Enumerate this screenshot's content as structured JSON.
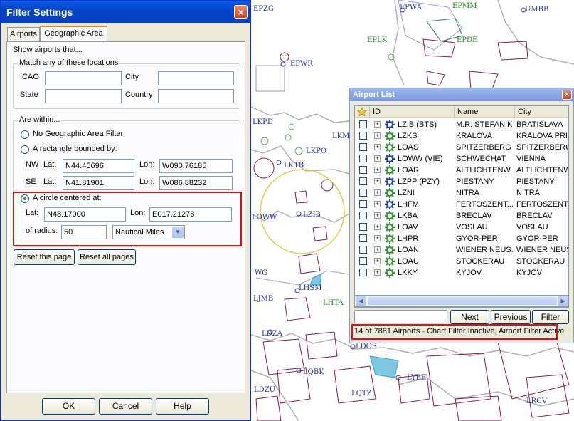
{
  "map": {
    "labels": [
      {
        "text": "EPZG",
        "color": "#2233aa"
      },
      {
        "text": "EPWA",
        "color": "#2233aa"
      },
      {
        "text": "EPMM",
        "color": "#228822"
      },
      {
        "text": "UMBB",
        "color": "#2233aa"
      },
      {
        "text": "EPLK",
        "color": "#228822"
      },
      {
        "text": "EPDE",
        "color": "#228822"
      },
      {
        "text": "EPWR",
        "color": "#2233aa"
      },
      {
        "text": "LKPD",
        "color": "#2233aa"
      },
      {
        "text": "LKM",
        "color": "#2233aa"
      },
      {
        "text": "LKPO",
        "color": "#2233aa"
      },
      {
        "text": "LKTB",
        "color": "#2233aa"
      },
      {
        "text": "LOWW",
        "color": "#2233aa"
      },
      {
        "text": "LZIB",
        "color": "#2233aa"
      },
      {
        "text": "WG",
        "color": "#2233aa"
      },
      {
        "text": "LHSM",
        "color": "#2233aa"
      },
      {
        "text": "LJMB",
        "color": "#2233aa"
      },
      {
        "text": "LHTA",
        "color": "#228822"
      },
      {
        "text": "LDZA",
        "color": "#2233aa"
      },
      {
        "text": "LDOS",
        "color": "#2233aa"
      },
      {
        "text": "LQBK",
        "color": "#2233aa"
      },
      {
        "text": "LYBE",
        "color": "#2233aa"
      },
      {
        "text": "LDZU",
        "color": "#2233aa"
      },
      {
        "text": "LQTZ",
        "color": "#2233aa"
      },
      {
        "text": "LRCV",
        "color": "#2233aa"
      }
    ]
  },
  "filter_window": {
    "title": "Filter Settings",
    "close_label": "×",
    "tabs": [
      {
        "label": "Airports"
      },
      {
        "label": "Geographic Area"
      }
    ],
    "intro": "Show airports that...",
    "match_group": {
      "title": "Match any of these locations",
      "icao_label": "ICAO",
      "icao_value": "",
      "city_label": "City",
      "city_value": "",
      "state_label": "State",
      "state_value": "",
      "country_label": "Country",
      "country_value": ""
    },
    "within_group": {
      "title": "Are within...",
      "opt_none": "No Geographic Area Filter",
      "opt_rect": "A rectangle bounded by:",
      "nw_label": "NW",
      "se_label": "SE",
      "lat_label": "Lat:",
      "lon_label": "Lon:",
      "nw_lat": "N44.45696",
      "nw_lon": "W090.76185",
      "se_lat": "N41.81901",
      "se_lon": "W086.88232",
      "opt_circle": "A circle centered at:",
      "circle_lat": "N48.17000",
      "circle_lon": "E017.21278",
      "radius_label": "of radius:",
      "radius_value": "50",
      "unit_value": "Nautical Miles"
    },
    "reset_page": "Reset this page",
    "reset_all": "Reset all pages",
    "ok": "OK",
    "cancel": "Cancel",
    "help": "Help"
  },
  "airport_list": {
    "title": "Airport List",
    "close_label": "×",
    "columns": {
      "id": "ID",
      "name": "Name",
      "city": "City"
    },
    "rows": [
      {
        "id": "LZIB (BTS)",
        "name": "M.R. STEFANIK",
        "city": "BRATISLAVA",
        "icon_color": "#1a3fb0"
      },
      {
        "id": "LZKS",
        "name": "KRALOVA",
        "city": "KRALOVA PRI S",
        "icon_color": "#2a9a2a"
      },
      {
        "id": "LOAS",
        "name": "SPITZERBERG",
        "city": "SPITZERBERG",
        "icon_color": "#2a9a2a"
      },
      {
        "id": "LOWW (VIE)",
        "name": "SCHWECHAT",
        "city": "VIENNA",
        "icon_color": "#1a3fb0"
      },
      {
        "id": "LOAR",
        "name": "ALTLICHTENW...",
        "city": "ALTLICHTENWA",
        "icon_color": "#2a9a2a"
      },
      {
        "id": "LZPP (PZY)",
        "name": "PIESTANY",
        "city": "PIESTANY",
        "icon_color": "#1a3fb0"
      },
      {
        "id": "LZNI",
        "name": "NITRA",
        "city": "NITRA",
        "icon_color": "#2a9a2a"
      },
      {
        "id": "LHFM",
        "name": "FERTOSZENT...",
        "city": "FERTOSZENTMI",
        "icon_color": "#1a3fb0"
      },
      {
        "id": "LKBA",
        "name": "BRECLAV",
        "city": "BRECLAV",
        "icon_color": "#2a9a2a"
      },
      {
        "id": "LOAV",
        "name": "VOSLAU",
        "city": "VOSLAU",
        "icon_color": "#2a9a2a"
      },
      {
        "id": "LHPR",
        "name": "GYOR-PER",
        "city": "GYOR-PER",
        "icon_color": "#2a9a2a"
      },
      {
        "id": "LOAN",
        "name": "WIENER NEUS...",
        "city": "WIENER NEUST",
        "icon_color": "#2a9a2a"
      },
      {
        "id": "LOAU",
        "name": "STOCKERAU",
        "city": "STOCKERAU",
        "icon_color": "#2a9a2a"
      },
      {
        "id": "LKKY",
        "name": "KYJOV",
        "city": "KYJOV",
        "icon_color": "#2a9a2a"
      }
    ],
    "search_value": "",
    "next": "Next",
    "previous": "Previous",
    "filter": "Filter",
    "status": "14 of 7881 Airports - Chart Filter Inactive, Airport Filter Active"
  }
}
